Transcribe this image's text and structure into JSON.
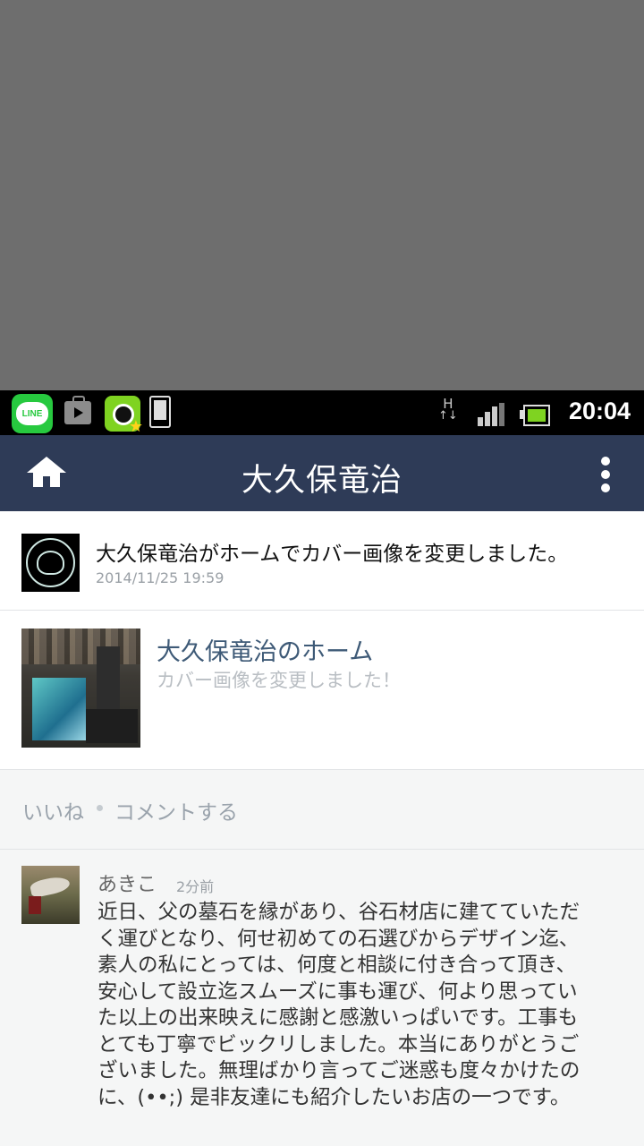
{
  "status_bar": {
    "network_type": "H",
    "time": "20:04",
    "line_label": "LINE",
    "icons": [
      "line-app-icon",
      "shopping-bag-icon",
      "camera-app-icon",
      "phone-device-icon",
      "network-h-icon",
      "signal-icon",
      "battery-icon"
    ]
  },
  "header": {
    "title": "大久保竜治",
    "home_icon": "home-icon",
    "menu_icon": "more-vertical-icon",
    "background": "#2e3b57"
  },
  "post": {
    "text": "大久保竜治がホームでカバー画像を変更しました。",
    "date": "2014/11/25 19:59"
  },
  "card": {
    "title": "大久保竜治のホーム",
    "subtitle": "カバー画像を変更しました！"
  },
  "actions": {
    "like": "いいね",
    "comment": "コメントする"
  },
  "comment": {
    "author": "あきこ",
    "time": "2分前",
    "lines": [
      "近日、父の墓石を縁があり、谷石材店に建てていただ",
      "く運びとなり、何せ初めての石選びからデザイン迄、",
      "素人の私にとっては、何度と相談に付き合って頂き、",
      "安心して設立迄スムーズに事も運び、何より思ってい",
      "た以上の出来映えに感謝と感激いっぱいです。工事も",
      "とても丁寧でビックリしました。本当にありがとうご",
      "ざいました。無理ばかり言ってご迷惑も度々かけたの",
      "に、(••;) 是非友達にも紹介したいお店の一つです。"
    ]
  },
  "colors": {
    "accent_link": "#3e5a77",
    "muted_text": "#9aa3ac",
    "line_green": "#27c93f"
  }
}
